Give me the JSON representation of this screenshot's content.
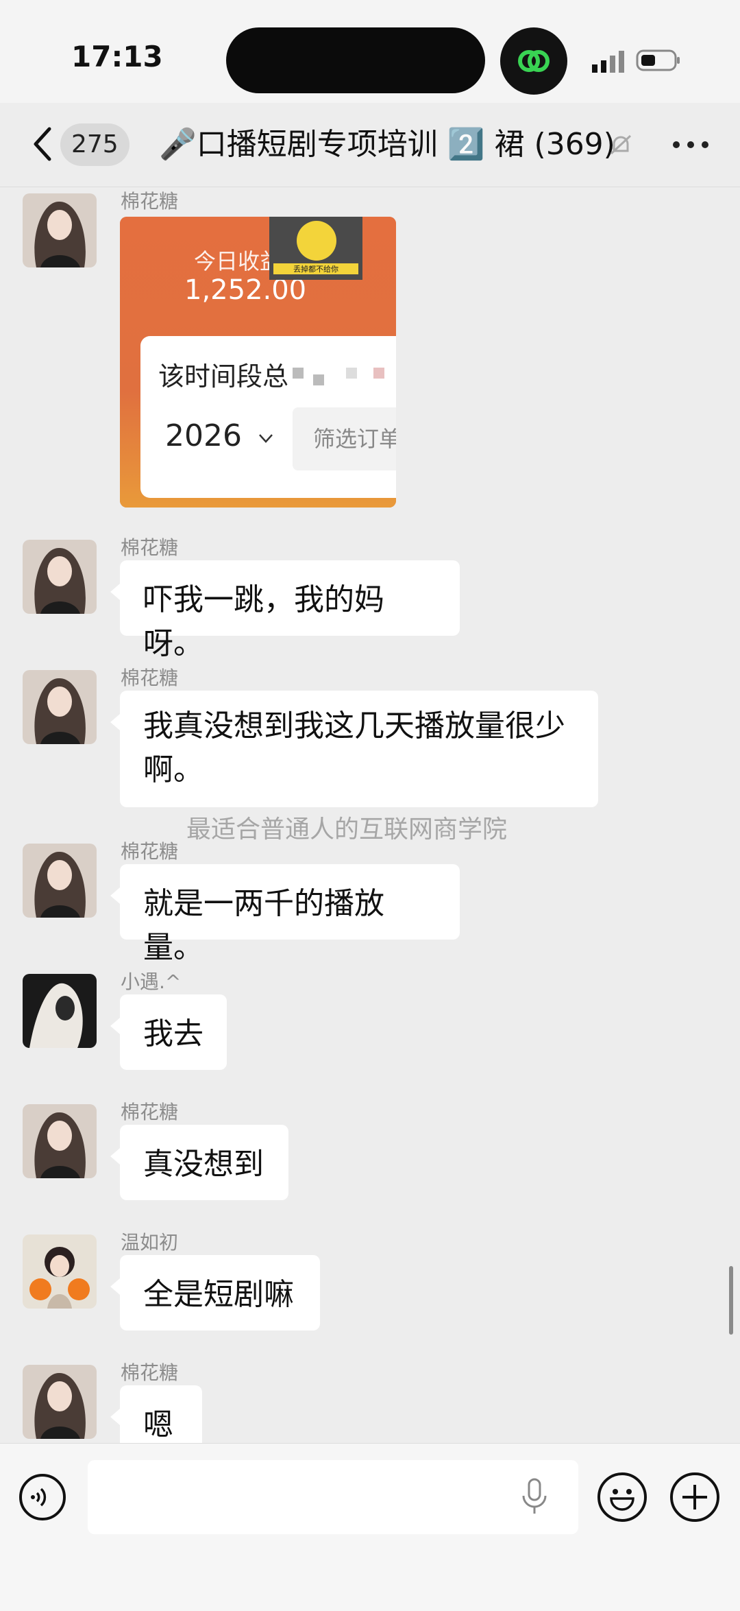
{
  "status_bar": {
    "time": "17:13"
  },
  "header": {
    "unread_count": "275",
    "title": "🎤口播短剧专项培训 2️⃣ 裙 (369)"
  },
  "image_message": {
    "sender": "棉花糖",
    "earnings_label": "今日收益",
    "earnings_value": "1,252.00",
    "sticker_caption": "丢掉都不给你",
    "period_label": "该时间段总",
    "year": "2026",
    "filter_label": "筛选订单"
  },
  "messages": [
    {
      "sender": "棉花糖",
      "text": "吓我一跳，我的妈呀。"
    },
    {
      "sender": "棉花糖",
      "text_line1": "我真没想到我这几天播放量很少",
      "text_line2": "啊。"
    },
    {
      "sender": "棉花糖",
      "text": "就是一两千的播放量。"
    },
    {
      "sender": "小遇.^",
      "text": "我去"
    },
    {
      "sender": "棉花糖",
      "text": "真没想到"
    },
    {
      "sender": "温如初",
      "text": "全是短剧嘛"
    },
    {
      "sender": "棉花糖",
      "text": "嗯"
    }
  ],
  "watermark": "最适合普通人的互联网商学院"
}
